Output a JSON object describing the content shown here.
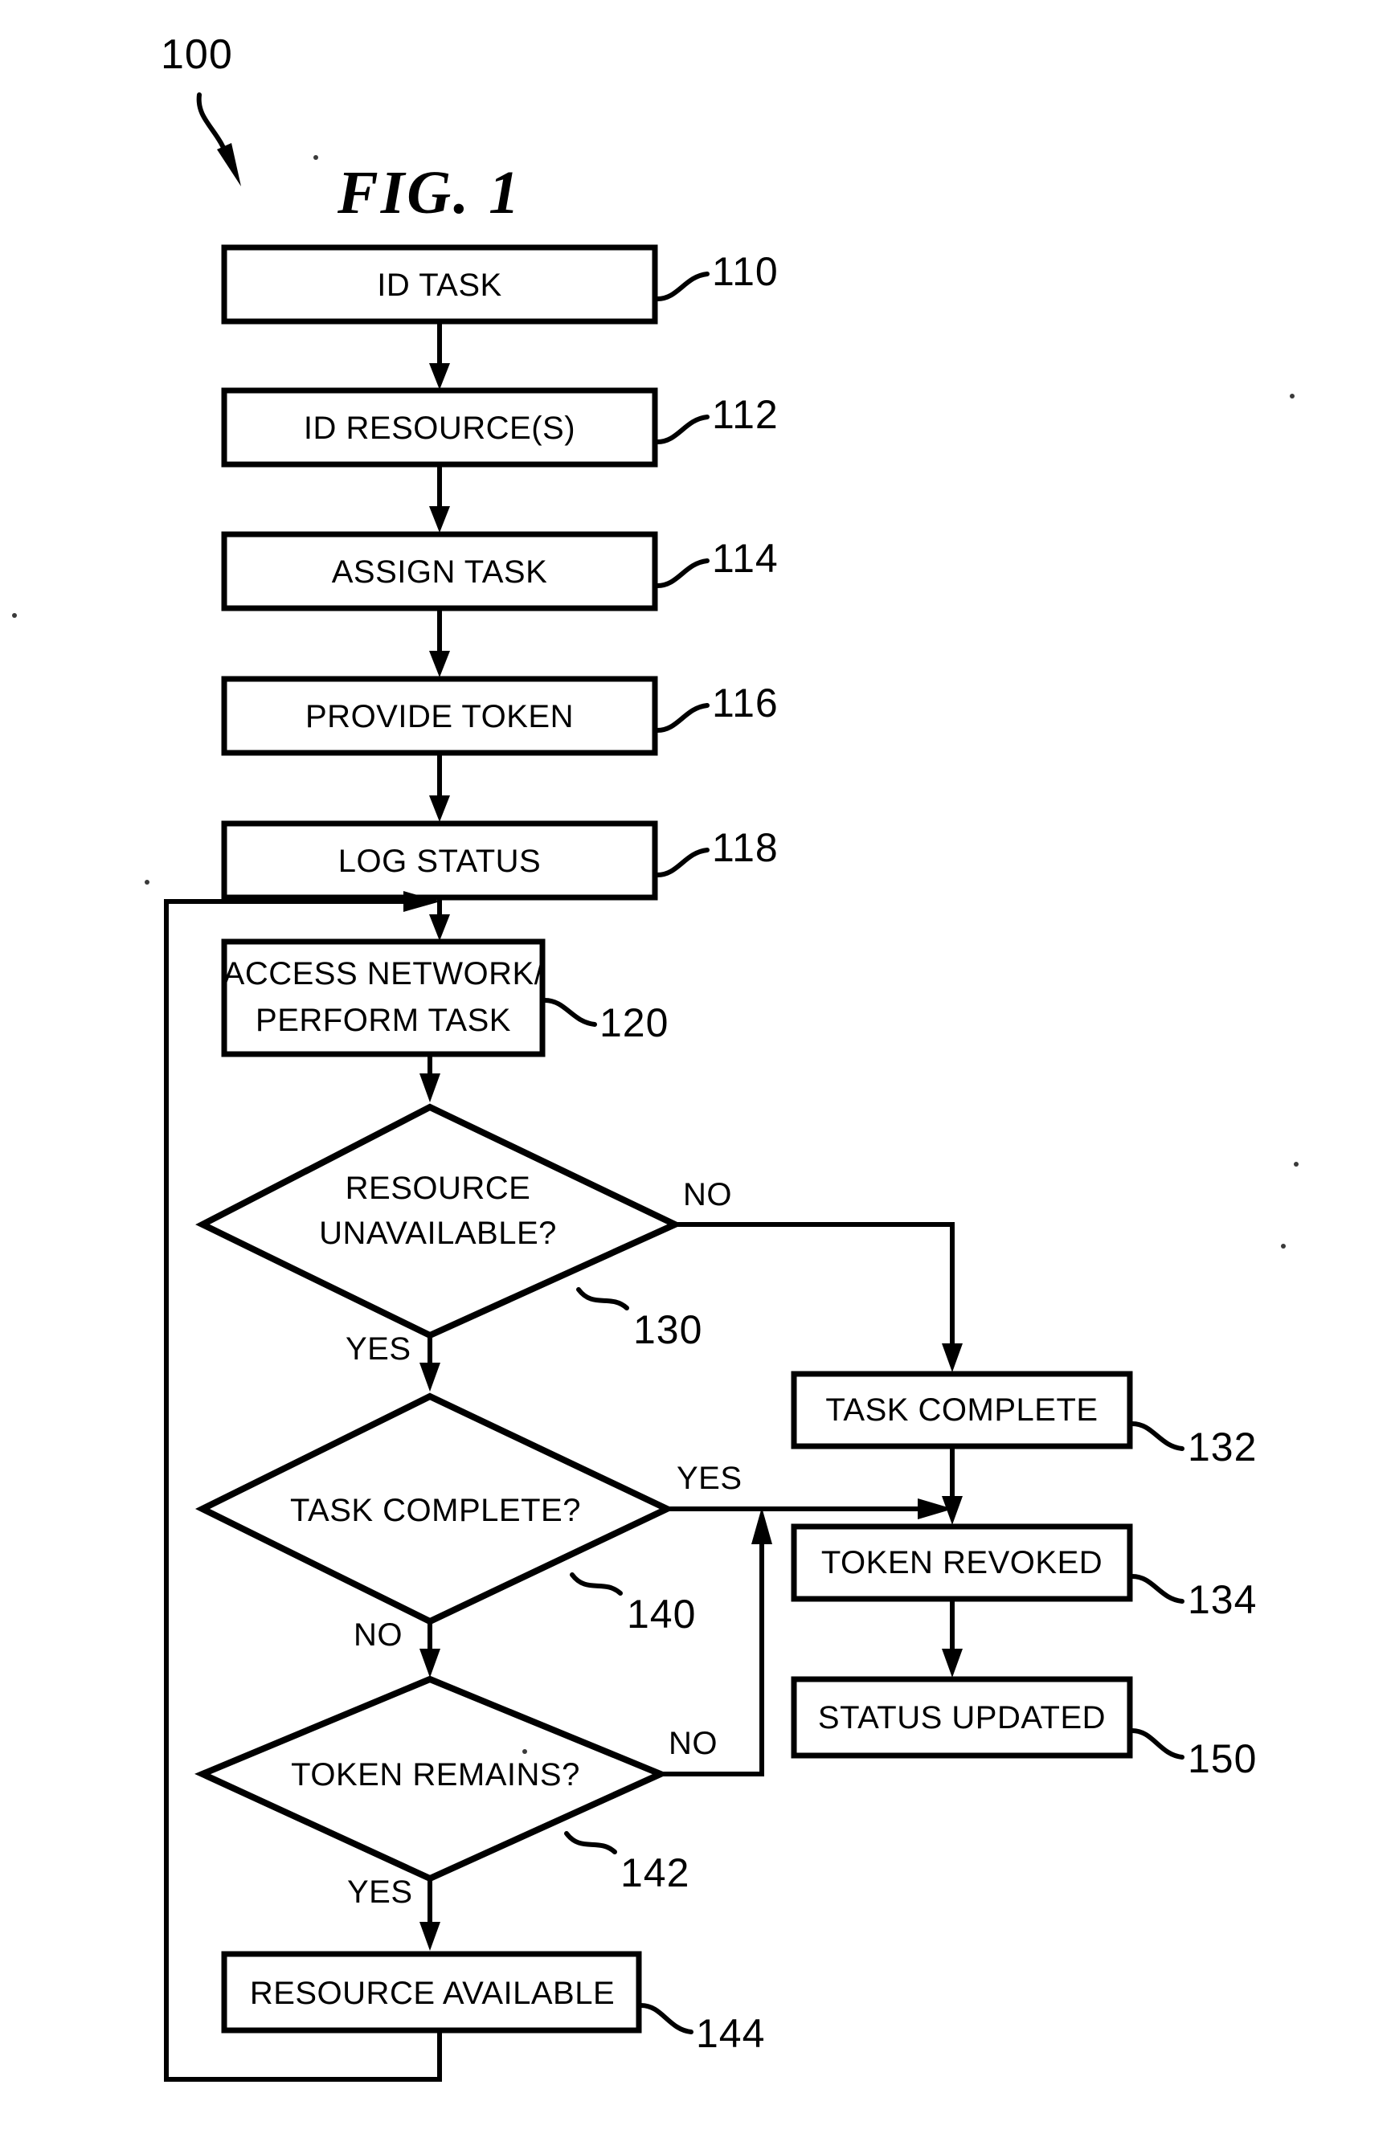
{
  "figure": {
    "title": "FIG. 1",
    "diagram_ref": "100",
    "type": "patent-flowchart"
  },
  "nodes": [
    {
      "id": "110",
      "label": "ID TASK",
      "shape": "process",
      "ref": "110"
    },
    {
      "id": "112",
      "label": "ID RESOURCE(S)",
      "shape": "process",
      "ref": "112"
    },
    {
      "id": "114",
      "label": "ASSIGN TASK",
      "shape": "process",
      "ref": "114"
    },
    {
      "id": "116",
      "label": "PROVIDE TOKEN",
      "shape": "process",
      "ref": "116"
    },
    {
      "id": "118",
      "label": "LOG STATUS",
      "shape": "process",
      "ref": "118"
    },
    {
      "id": "120",
      "label_line1": "ACCESS NETWORK/",
      "label_line2": "PERFORM TASK",
      "shape": "process",
      "ref": "120"
    },
    {
      "id": "130",
      "label_line1": "RESOURCE",
      "label_line2": "UNAVAILABLE?",
      "shape": "decision",
      "ref": "130"
    },
    {
      "id": "132",
      "label": "TASK COMPLETE",
      "shape": "process",
      "ref": "132"
    },
    {
      "id": "134",
      "label": "TOKEN REVOKED",
      "shape": "process",
      "ref": "134"
    },
    {
      "id": "140",
      "label": "TASK COMPLETE?",
      "shape": "decision",
      "ref": "140"
    },
    {
      "id": "142",
      "label": "TOKEN REMAINS?",
      "shape": "decision",
      "ref": "142"
    },
    {
      "id": "144",
      "label": "RESOURCE AVAILABLE",
      "shape": "process",
      "ref": "144"
    },
    {
      "id": "150",
      "label": "STATUS UPDATED",
      "shape": "process",
      "ref": "150"
    }
  ],
  "branch_labels": {
    "d130_no": "NO",
    "d130_yes": "YES",
    "d140_yes": "YES",
    "d140_no": "NO",
    "d142_no": "NO",
    "d142_yes": "YES"
  },
  "colors": {
    "ink": "#000000",
    "paper": "#ffffff"
  }
}
